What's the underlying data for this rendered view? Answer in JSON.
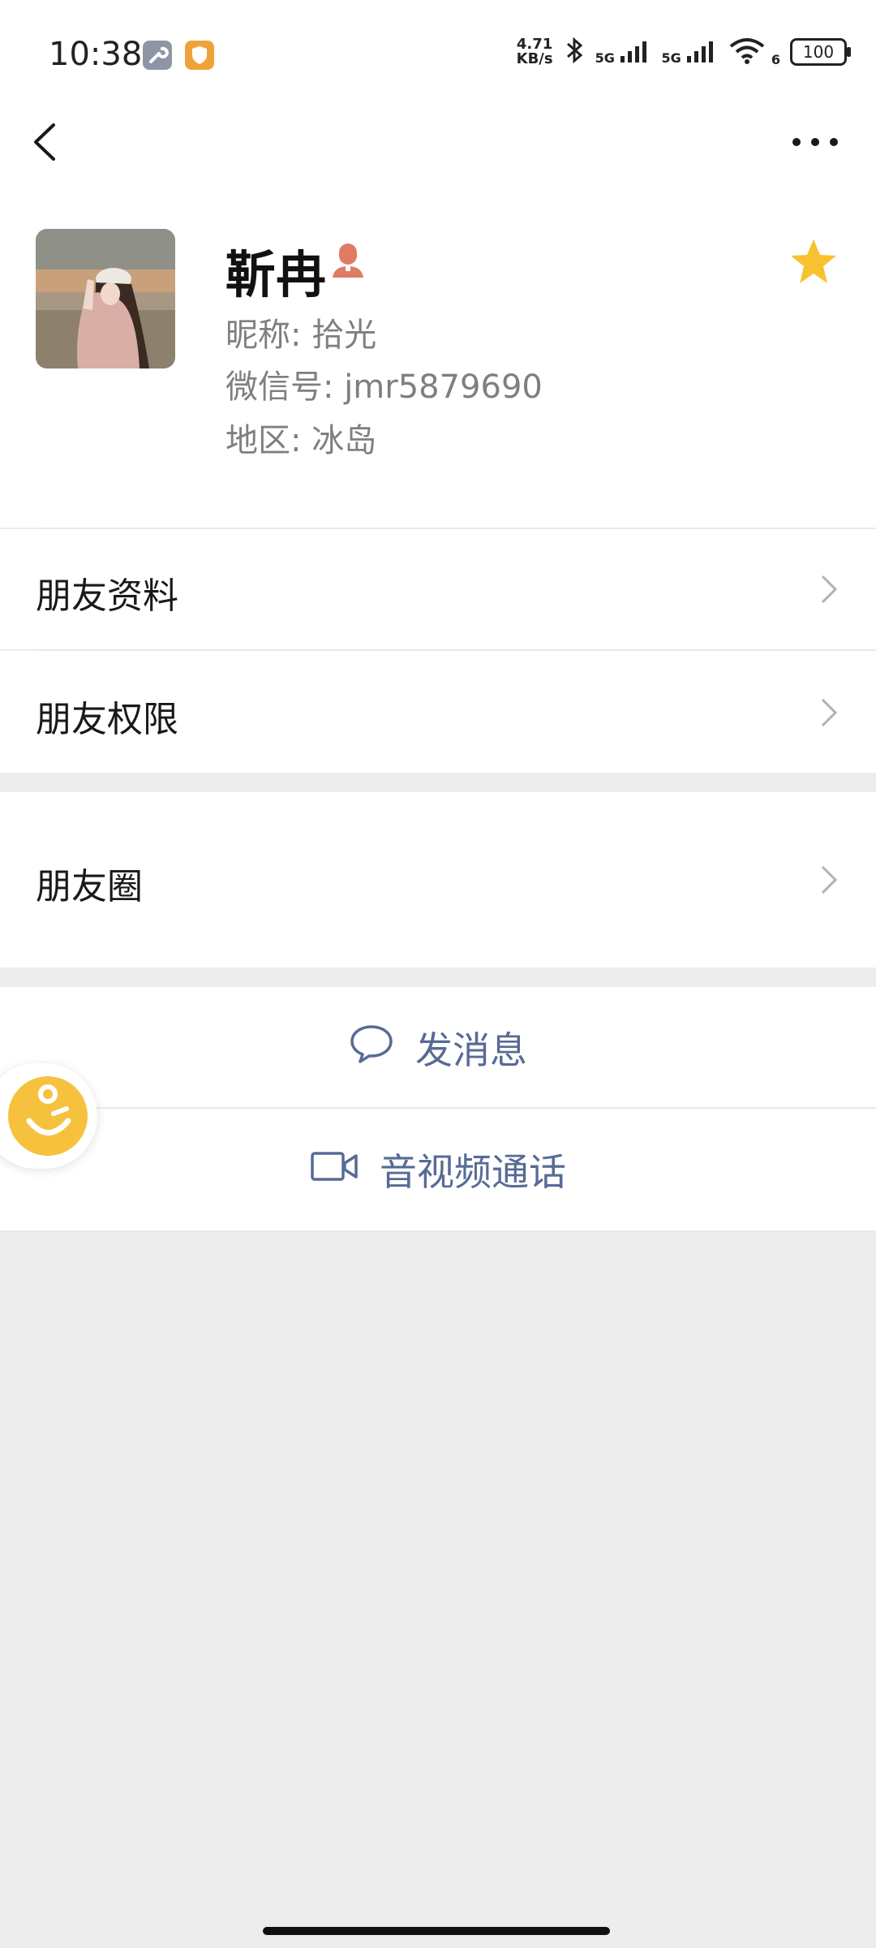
{
  "status_bar": {
    "time": "10:38",
    "net_speed_value": "4.71",
    "net_speed_unit": "KB/s",
    "signal_1": "5G",
    "signal_2": "5G",
    "wifi_badge": "6",
    "battery": "100"
  },
  "profile": {
    "name": "靳冉",
    "nickname": "昵称:  拾光",
    "wechat_id": "微信号:  jmr5879690",
    "region": "地区:  冰岛"
  },
  "menu": {
    "friend_info": "朋友资料",
    "friend_permissions": "朋友权限",
    "moments": "朋友圈"
  },
  "actions": {
    "send_message": "发消息",
    "video_call": "音视频通话"
  },
  "colors": {
    "link_blue": "#576b95",
    "star_yellow": "#f7c12f",
    "gender_icon": "#e07b63",
    "background": "#ededed"
  },
  "icons": {
    "back": "chevron-left-icon",
    "more": "more-horizontal-icon",
    "star": "star-icon",
    "chat": "chat-bubble-icon",
    "video": "video-camera-icon",
    "chevron": "chevron-right-icon"
  }
}
